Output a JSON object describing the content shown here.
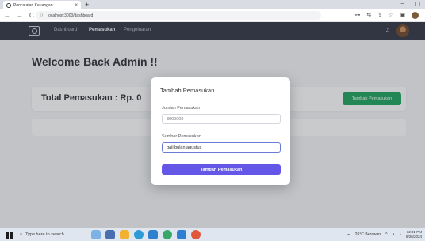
{
  "browser": {
    "tab_title": "Pencatatan Keuangan",
    "tab_close": "×",
    "new_tab": "+",
    "url": "localhost:3000/dashboard",
    "nav": {
      "back": "←",
      "forward": "→",
      "reload": "C"
    },
    "window_controls": {
      "minimize": "–",
      "maximize": "▢"
    }
  },
  "app_nav": {
    "links": [
      "Dashboard",
      "Pemasukan",
      "Pengeluaran"
    ],
    "active": "Pemasukan"
  },
  "main": {
    "welcome": "Welcome Back Admin !!",
    "total_label": "Total Pemasukan : Rp. 0",
    "add_button": "Tambah Pemasukan"
  },
  "modal": {
    "title": "Tambah Pemasukan",
    "fields": [
      {
        "label": "Jumlah Pemasukan",
        "value": "3000000"
      },
      {
        "label": "Sumber Pemasukan",
        "value": "gaji bulan agustus"
      }
    ],
    "submit": "Tambah Pemasukan"
  },
  "taskbar": {
    "search_placeholder": "Type here to search",
    "weather": "26°C Berawan",
    "time": "12:01 PM",
    "date": "8/26/2024"
  },
  "colors": {
    "nav_bg": "#2d3240",
    "add_button": "#1aa35a",
    "submit_button": "#6457e8"
  }
}
